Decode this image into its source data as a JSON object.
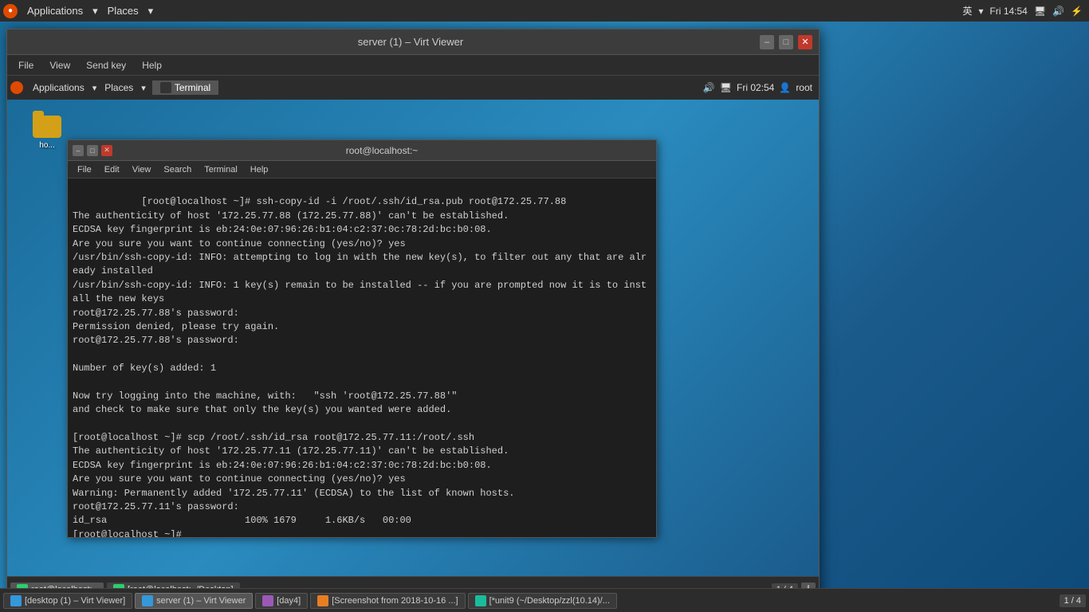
{
  "host": {
    "taskbar": {
      "app_icon_label": "●",
      "applications_label": "Applications",
      "places_label": "Places",
      "lang_indicator": "英",
      "time": "Fri 14:54",
      "icons": [
        "🖥",
        "🔊",
        "⚡"
      ]
    },
    "bottom_taskbar": {
      "tasks": [
        {
          "id": "desktop1",
          "label": "[desktop (1) – Virt Viewer]",
          "icon_class": "task-icon-virt",
          "active": false
        },
        {
          "id": "server1",
          "label": "server (1) – Virt Viewer",
          "icon_class": "task-icon-virt",
          "active": true
        },
        {
          "id": "day4",
          "label": "[day4]",
          "icon_class": "task-icon-day",
          "active": false
        },
        {
          "id": "screenshot",
          "label": "[Screenshot from 2018-10-16 ...]",
          "icon_class": "task-icon-screenshot",
          "active": false
        },
        {
          "id": "unit9",
          "label": "[*unit9 (~/Desktop/zzl(10.14)/...",
          "icon_class": "task-icon-unit",
          "active": false
        }
      ],
      "pager": "1 / 4"
    }
  },
  "virt_viewer": {
    "title": "server (1) – Virt Viewer",
    "menubar": {
      "items": [
        "File",
        "View",
        "Send key",
        "Help"
      ]
    },
    "wm_buttons": {
      "minimize": "–",
      "maximize": "□",
      "close": "✕"
    }
  },
  "guest_vm": {
    "taskbar": {
      "applications_label": "Applications",
      "places_label": "Places",
      "terminal_tab": "Terminal",
      "volume_icon": "🔊",
      "network_icon": "🖥",
      "time": "Fri 02:54",
      "user_icon": "👤",
      "user": "root"
    },
    "desktop_icon": {
      "label": "ho..."
    },
    "terminal": {
      "title": "root@localhost:~",
      "menubar_items": [
        "File",
        "Edit",
        "View",
        "Search",
        "Terminal",
        "Help"
      ],
      "content": "[root@localhost ~]# ssh-copy-id -i /root/.ssh/id_rsa.pub root@172.25.77.88\nThe authenticity of host '172.25.77.88 (172.25.77.88)' can't be established.\nECDSA key fingerprint is eb:24:0e:07:96:26:b1:04:c2:37:0c:78:2d:bc:b0:08.\nAre you sure you want to continue connecting (yes/no)? yes\n/usr/bin/ssh-copy-id: INFO: attempting to log in with the new key(s), to filter out any that are already installed\n/usr/bin/ssh-copy-id: INFO: 1 key(s) remain to be installed -- if you are prompted now it is to install the new keys\nroot@172.25.77.88's password: \nPermission denied, please try again.\nroot@172.25.77.88's password: \n\nNumber of key(s) added: 1\n\nNow try logging into the machine, with:   \"ssh 'root@172.25.77.88'\"\nand check to make sure that only the key(s) you wanted were added.\n\n[root@localhost ~]# scp /root/.ssh/id_rsa root@172.25.77.11:/root/.ssh\nThe authenticity of host '172.25.77.11 (172.25.77.11)' can't be established.\nECDSA key fingerprint is eb:24:0e:07:96:26:b1:04:c2:37:0c:78:2d:bc:b0:08.\nAre you sure you want to continue connecting (yes/no)? yes\nWarning: Permanently added '172.25.77.11' (ECDSA) to the list of known hosts.\nroot@172.25.77.11's password: \nid_rsa                        100% 1679     1.6KB/s   00:00    \n[root@localhost ~]# ",
      "wm_buttons": {
        "minimize": "–",
        "maximize": "□",
        "close": "✕"
      }
    },
    "bottom_taskbar": {
      "tasks": [
        {
          "label": "root@localhost:~",
          "active": true
        },
        {
          "label": "[root@localhost:~/Desktop]",
          "active": false
        }
      ],
      "pager": "1 / 4",
      "info_icon": "ℹ"
    }
  }
}
